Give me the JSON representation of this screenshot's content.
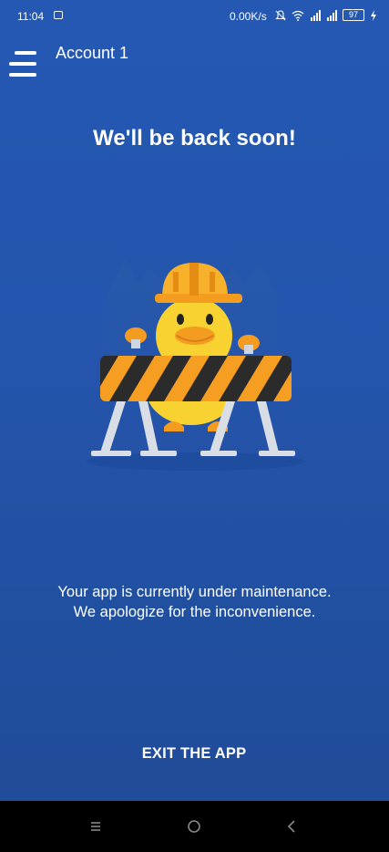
{
  "status_bar": {
    "time": "11:04",
    "network_speed": "0.00K/s",
    "battery": "97"
  },
  "app_bar": {
    "title": "Account 1"
  },
  "maintenance": {
    "heading": "We'll be back soon!",
    "message_line1": "Your app is currently under maintenance.",
    "message_line2": "We apologize for the inconvenience.",
    "exit_label": "EXIT THE APP"
  },
  "colors": {
    "background": "#2458b3",
    "duck": "#f8d231",
    "helmet": "#f39c1f",
    "barrier_dark": "#2b2b2b",
    "barrier_stripe": "#f59e22"
  }
}
